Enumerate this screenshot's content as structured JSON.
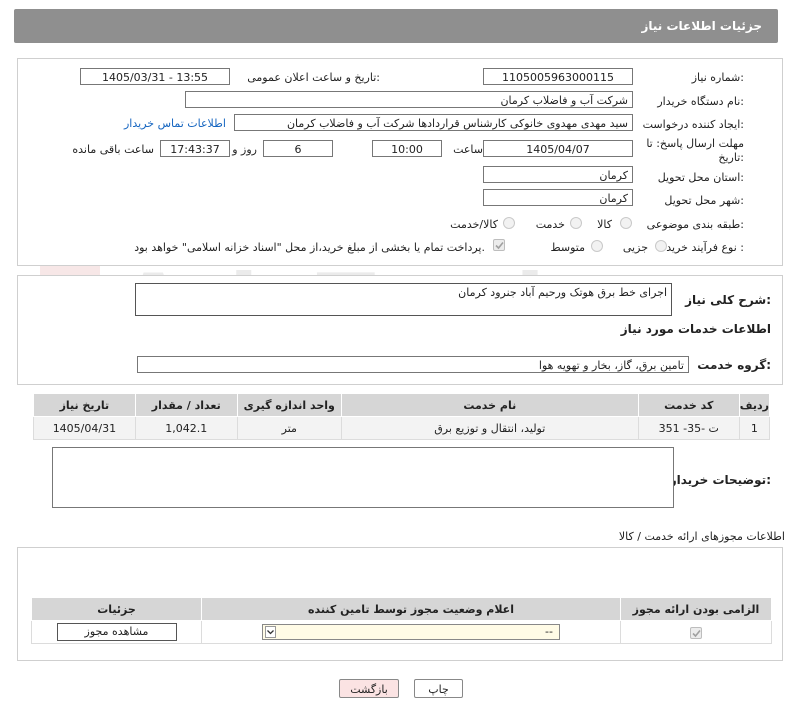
{
  "header": {
    "title": "جزئیات اطلاعات نیاز"
  },
  "form": {
    "need_number_label": "شماره نیاز:",
    "need_number": "1105005963000115",
    "announce_label": "تاریخ و ساعت اعلان عمومی:",
    "announce_value": "1405/03/31 - 13:55",
    "buyer_org_label": "نام دستگاه خریدار:",
    "buyer_org": "شرکت آب و فاضلاب کرمان",
    "creator_label": "ایجاد کننده درخواست:",
    "creator": "سید مهدی  مهدوی خانوکی کارشناس قراردادها شرکت آب و فاضلاب کرمان",
    "contact_link": "اطلاعات تماس خریدار",
    "deadline_label": "مهلت ارسال پاسخ: تا تاریخ:",
    "deadline_date": "1405/04/07",
    "time_label": "ساعت",
    "deadline_time": "10:00",
    "days_value": "6",
    "days_label": "روز و",
    "remaining_time": "17:43:37",
    "remaining_label": "ساعت باقی مانده",
    "province_label": "استان محل تحویل:",
    "province": "کرمان",
    "city_label": "شهر محل تحویل:",
    "city": "کرمان",
    "category_label": "طبقه بندی موضوعی:",
    "category_options": [
      "کالا",
      "خدمت",
      "کالا/خدمت"
    ],
    "process_label": "نوع فرآیند خرید :",
    "process_options": [
      "جزیی",
      "متوسط"
    ],
    "payment_note": "پرداخت تمام یا بخشی از مبلغ خرید،از محل \"اسناد خزانه اسلامی\" خواهد بود."
  },
  "summary": {
    "label": "شرح کلی نیاز:",
    "value": "اجرای خط برق هوتک ورحیم آباد جنرود کرمان",
    "services_title": "اطلاعات خدمات مورد نیاز",
    "group_label": "گروه خدمت:",
    "group_value": "تامین برق، گاز، بخار و تهویه هوا"
  },
  "services_table": {
    "headers": [
      "ردیف",
      "کد خدمت",
      "نام خدمت",
      "واحد اندازه گیری",
      "تعداد / مقدار",
      "تاریخ نیاز"
    ],
    "rows": [
      [
        "1",
        "ت -35- 351",
        "تولید، انتقال و توزیع برق",
        "متر",
        "1,042.1",
        "1405/04/31"
      ]
    ]
  },
  "buyer_notes": {
    "label": "توضیحات خریدار:",
    "value": ""
  },
  "permits": {
    "title": "اطلاعات مجوزهای ارائه خدمت / کالا",
    "headers": [
      "الزامی بودن ارائه مجوز",
      "اعلام وضعیت مجوز توسط تامین کننده",
      "جزئیات"
    ],
    "select_value": "--",
    "view_button": "مشاهده مجوز"
  },
  "footer": {
    "print_button": "چاپ",
    "back_button": "بازگشت"
  },
  "watermark": "AriaTender.net",
  "colors": {
    "header_bg": "#8f8f8f",
    "link": "#1565c0",
    "back_bg": "#fbe3e3",
    "table_header": "#d6d6d6"
  }
}
